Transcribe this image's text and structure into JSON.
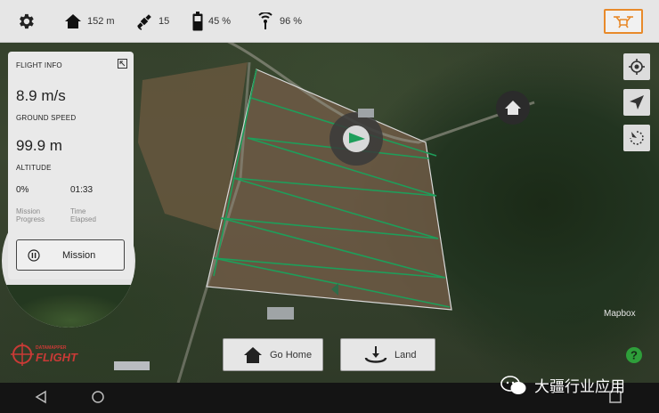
{
  "top_bar": {
    "settings_icon": "gear-icon",
    "home_distance": "152 m",
    "satellites": "15",
    "battery": "45 %",
    "signal": "96 %",
    "drone_icon": "drone-icon"
  },
  "flight_info": {
    "title": "FLIGHT INFO",
    "speed_value": "8.9 m/s",
    "speed_label": "GROUND SPEED",
    "altitude_value": "99.9 m",
    "altitude_label": "ALTITUDE",
    "progress_value": "0%",
    "progress_label_1": "Mission",
    "progress_label_2": "Progress",
    "time_value": "01:33",
    "time_label_1": "Time",
    "time_label_2": "Elapsed"
  },
  "mission_button": {
    "label": "Mission"
  },
  "bottom_buttons": {
    "go_home": "Go Home",
    "land": "Land"
  },
  "map": {
    "attribution": "Mapbox",
    "flight_path_color": "#1e9e5a",
    "boundary_color": "#d9d9d9"
  },
  "logo": {
    "small_text": "DATAMAPPER",
    "main_text": "FLIGHT"
  },
  "watermark": {
    "text": "大疆行业应用"
  },
  "colors": {
    "accent_orange": "#e88a2a",
    "help_green": "#2e9e3a",
    "logo_red": "#c93a36"
  }
}
